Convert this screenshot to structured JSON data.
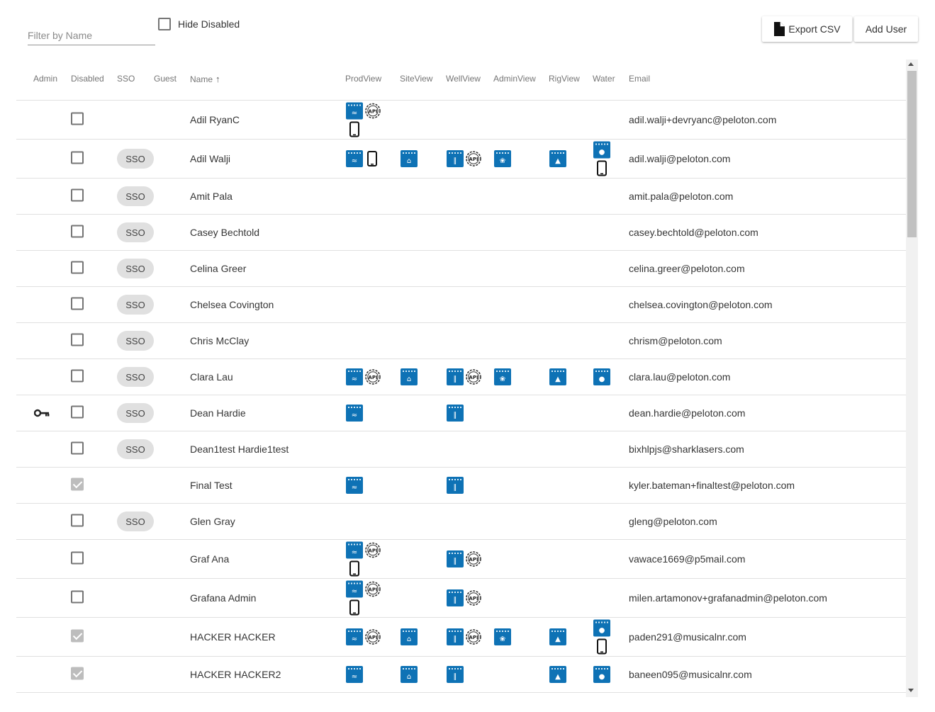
{
  "toolbar": {
    "filter_placeholder": "Filter by Name",
    "hide_disabled_label": "Hide Disabled",
    "export_label": "Export CSV",
    "add_label": "Add User"
  },
  "columns": {
    "admin": "Admin",
    "disabled": "Disabled",
    "sso": "SSO",
    "guest": "Guest",
    "name": "Name",
    "prodview": "ProdView",
    "siteview": "SiteView",
    "wellview": "WellView",
    "adminview": "AdminView",
    "rigview": "RigView",
    "water": "Water",
    "email": "Email"
  },
  "sso_label": "SSO",
  "colors": {
    "app_blue": "#0e72b5",
    "sso_chip": "#e0e0e0",
    "checked_gray": "#bdbdbd"
  },
  "users": [
    {
      "name": "Adil RyanC",
      "email": "adil.walji+devryanc@peloton.com",
      "admin": false,
      "disabled": false,
      "sso": false,
      "tall": true,
      "prod": [
        "prod",
        "api",
        "phone"
      ],
      "site": [],
      "well": [],
      "adminv": [],
      "rig": [],
      "water": []
    },
    {
      "name": "Adil Walji",
      "email": "adil.walji@peloton.com",
      "admin": false,
      "disabled": false,
      "sso": true,
      "tall": true,
      "prod": [
        "prod",
        "phone"
      ],
      "site": [
        "site"
      ],
      "well": [
        "well",
        "api"
      ],
      "adminv": [
        "admin"
      ],
      "rig": [
        "rig"
      ],
      "water": [
        "water",
        "phone"
      ]
    },
    {
      "name": "Amit Pala",
      "email": "amit.pala@peloton.com",
      "admin": false,
      "disabled": false,
      "sso": true,
      "prod": [],
      "site": [],
      "well": [],
      "adminv": [],
      "rig": [],
      "water": []
    },
    {
      "name": "Casey Bechtold",
      "email": "casey.bechtold@peloton.com",
      "admin": false,
      "disabled": false,
      "sso": true,
      "prod": [],
      "site": [],
      "well": [],
      "adminv": [],
      "rig": [],
      "water": []
    },
    {
      "name": "Celina Greer",
      "email": "celina.greer@peloton.com",
      "admin": false,
      "disabled": false,
      "sso": true,
      "prod": [],
      "site": [],
      "well": [],
      "adminv": [],
      "rig": [],
      "water": []
    },
    {
      "name": "Chelsea Covington",
      "email": "chelsea.covington@peloton.com",
      "admin": false,
      "disabled": false,
      "sso": true,
      "prod": [],
      "site": [],
      "well": [],
      "adminv": [],
      "rig": [],
      "water": []
    },
    {
      "name": "Chris McClay",
      "email": "chrism@peloton.com",
      "admin": false,
      "disabled": false,
      "sso": true,
      "prod": [],
      "site": [],
      "well": [],
      "adminv": [],
      "rig": [],
      "water": []
    },
    {
      "name": "Clara Lau",
      "email": "clara.lau@peloton.com",
      "admin": false,
      "disabled": false,
      "sso": true,
      "prod": [
        "prod",
        "api"
      ],
      "site": [
        "site"
      ],
      "well": [
        "well",
        "api"
      ],
      "adminv": [
        "admin"
      ],
      "rig": [
        "rig"
      ],
      "water": [
        "water"
      ]
    },
    {
      "name": "Dean Hardie",
      "email": "dean.hardie@peloton.com",
      "admin": true,
      "disabled": false,
      "sso": true,
      "prod": [
        "prod"
      ],
      "site": [],
      "well": [
        "well"
      ],
      "adminv": [],
      "rig": [],
      "water": []
    },
    {
      "name": "Dean1test Hardie1test",
      "email": "bixhlpjs@sharklasers.com",
      "admin": false,
      "disabled": false,
      "sso": true,
      "prod": [],
      "site": [],
      "well": [],
      "adminv": [],
      "rig": [],
      "water": []
    },
    {
      "name": "Final Test",
      "email": "kyler.bateman+finaltest@peloton.com",
      "admin": false,
      "disabled": true,
      "sso": false,
      "prod": [
        "prod"
      ],
      "site": [],
      "well": [
        "well"
      ],
      "adminv": [],
      "rig": [],
      "water": []
    },
    {
      "name": "Glen Gray",
      "email": "gleng@peloton.com",
      "admin": false,
      "disabled": false,
      "sso": true,
      "prod": [],
      "site": [],
      "well": [],
      "adminv": [],
      "rig": [],
      "water": []
    },
    {
      "name": "Graf Ana",
      "email": "vawace1669@p5mail.com",
      "admin": false,
      "disabled": false,
      "sso": false,
      "tall": true,
      "prod": [
        "prod",
        "api",
        "phone"
      ],
      "site": [],
      "well": [
        "well",
        "api"
      ],
      "adminv": [],
      "rig": [],
      "water": []
    },
    {
      "name": "Grafana Admin",
      "email": "milen.artamonov+grafanadmin@peloton.com",
      "admin": false,
      "disabled": false,
      "sso": false,
      "tall": true,
      "prod": [
        "prod",
        "api",
        "phone"
      ],
      "site": [],
      "well": [
        "well",
        "api"
      ],
      "adminv": [],
      "rig": [],
      "water": []
    },
    {
      "name": "HACKER HACKER",
      "email": "paden291@musicalnr.com",
      "admin": false,
      "disabled": true,
      "sso": false,
      "tall": true,
      "prod": [
        "prod",
        "api"
      ],
      "site": [
        "site"
      ],
      "well": [
        "well",
        "api"
      ],
      "adminv": [
        "admin"
      ],
      "rig": [
        "rig"
      ],
      "water": [
        "water",
        "phone"
      ]
    },
    {
      "name": "HACKER HACKER2",
      "email": "baneen095@musicalnr.com",
      "admin": false,
      "disabled": true,
      "sso": false,
      "prod": [
        "prod"
      ],
      "site": [
        "site"
      ],
      "well": [
        "well"
      ],
      "adminv": [],
      "rig": [
        "rig"
      ],
      "water": [
        "water"
      ]
    }
  ]
}
